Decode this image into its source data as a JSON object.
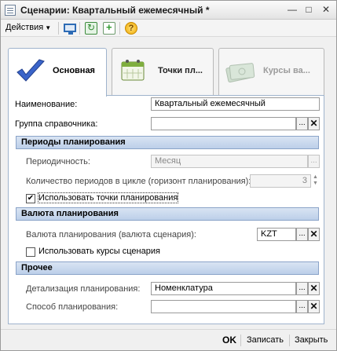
{
  "window": {
    "title": "Сценарии: Квартальный ежемесячный *",
    "minimize": "—",
    "maximize": "□",
    "close": "✕"
  },
  "toolbar": {
    "actions_label": "Действия",
    "help_glyph": "?"
  },
  "tabs": [
    {
      "label": "Основная"
    },
    {
      "label": "Точки пл..."
    },
    {
      "label": "Курсы ва..."
    }
  ],
  "form": {
    "name_label": "Наименование:",
    "name_value": "Квартальный ежемесячный",
    "group_label": "Группа справочника:",
    "group_value": "",
    "section_periods": "Периоды планирования",
    "periodicity_label": "Периодичность:",
    "periodicity_value": "Месяц",
    "periods_count_label": "Количество периодов в цикле (горизонт планирования):",
    "periods_count_value": "3",
    "use_points_label": "Использовать точки планирования",
    "use_points_checked": "✔",
    "section_currency": "Валюта планирования",
    "currency_label": "Валюта планирования (валюта сценария):",
    "currency_value": "KZT",
    "use_rates_label": "Использовать курсы сценария",
    "use_rates_checked": "",
    "section_other": "Прочее",
    "detail_label": "Детализация планирования:",
    "detail_value": "Номенклатура",
    "method_label": "Способ планирования:",
    "method_value": ""
  },
  "buttons": {
    "ellipsis": "...",
    "clear": "✕",
    "spin_up": "▲",
    "spin_down": "▼"
  },
  "footer": {
    "ok": "OK",
    "save": "Записать",
    "close": "Закрыть"
  }
}
